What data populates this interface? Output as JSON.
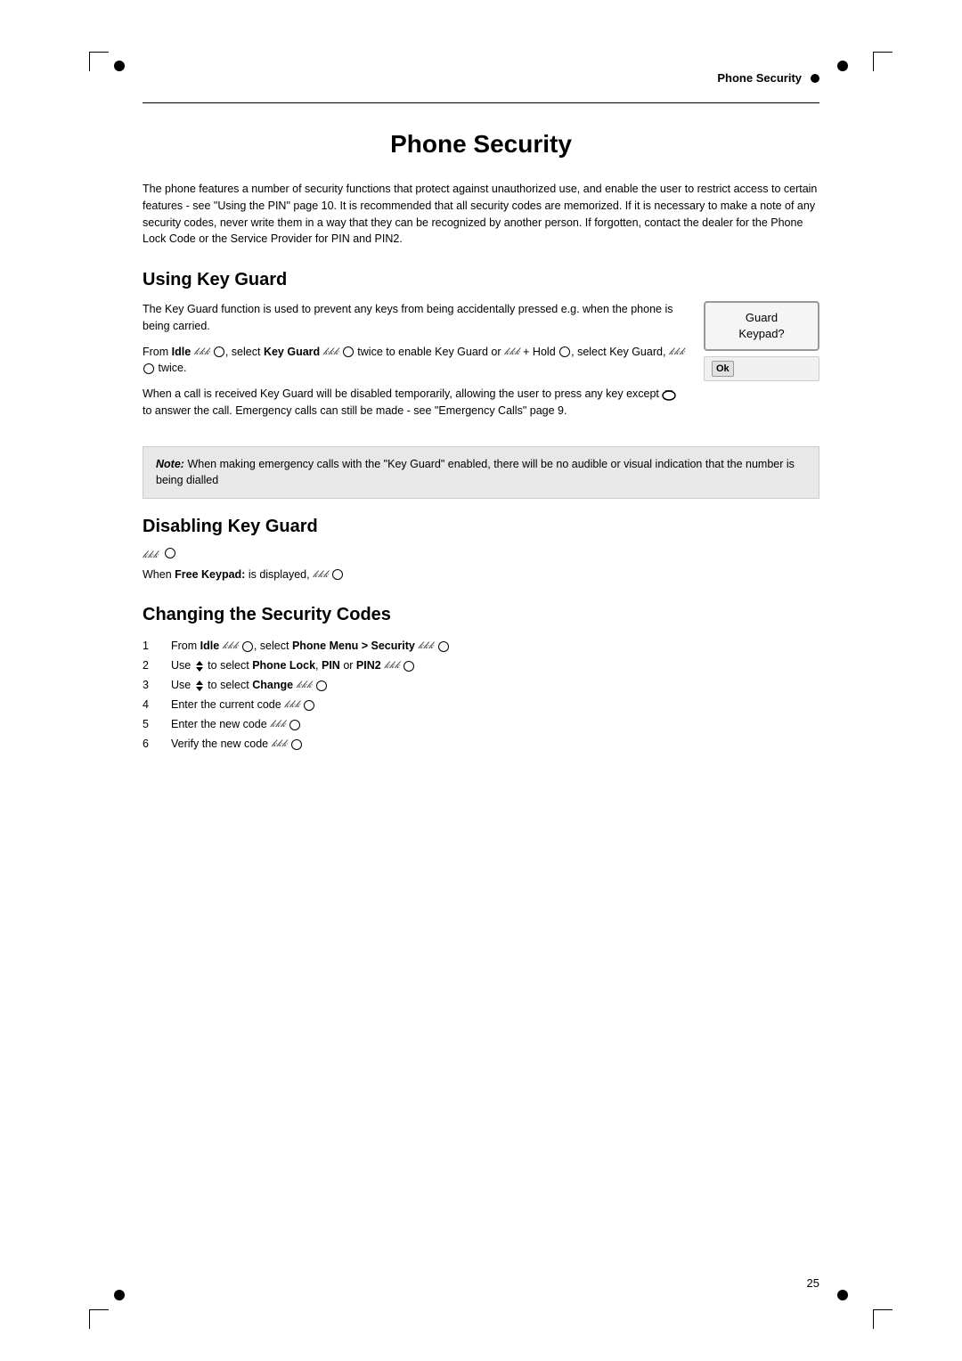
{
  "page": {
    "number": "25",
    "header": {
      "title": "Phone Security"
    },
    "main_title": "Phone Security",
    "intro_paragraph": "The phone features a number of security functions that protect against unauthorized use, and enable the user to restrict access to certain features - see \"Using the PIN\" page 10. It is recommended that all security codes are memorized. If it is necessary to make a note of any security codes, never write them in a way that they can be recognized by another person. If forgotten, contact the dealer for the Phone Lock Code or the Service Provider for PIN and PIN2.",
    "sections": {
      "using_key_guard": {
        "heading": "Using Key Guard",
        "paragraph1": "The Key Guard function is used to prevent any keys from being accidentally pressed e.g. when the phone is being carried.",
        "paragraph2_prefix": "From ",
        "paragraph2_idle": "Idle",
        "paragraph2_mid": ", select ",
        "paragraph2_key_guard": "Key Guard",
        "paragraph2_suffix": " twice to enable Key Guard or",
        "paragraph2_hold": "+ Hold",
        "paragraph2_end": ", select Key Guard,",
        "paragraph2_twice": " twice.",
        "paragraph3": "When a call is received Key Guard will be disabled temporarily, allowing the user to press any key except",
        "paragraph3_suffix": "to answer the call. Emergency calls can still be made - see \"Emergency Calls\" page 9.",
        "phone_display": {
          "text": "Guard\nKeypad?",
          "btn_ok": "Ok",
          "btn_cancel": ""
        },
        "note": {
          "prefix": "Note:",
          "text": " When making emergency calls with the \"Key Guard\" enabled, there will be no audible or visual indication that the number is being dialled"
        }
      },
      "disabling_key_guard": {
        "heading": "Disabling Key Guard",
        "line1": "When ",
        "line1_bold": "Free Keypad:",
        "line1_suffix": " is displayed,"
      },
      "changing_security_codes": {
        "heading": "Changing the Security Codes",
        "steps": [
          {
            "num": "1",
            "prefix": "From ",
            "idle": "Idle",
            "mid": ", select ",
            "bold": "Phone Menu > Security"
          },
          {
            "num": "2",
            "prefix": "Use",
            "nav": "↕",
            "mid": "to select ",
            "bold": "Phone Lock",
            "sep1": ", ",
            "bold2": "PIN",
            "sep2": " or ",
            "bold3": "PIN2"
          },
          {
            "num": "3",
            "prefix": "Use",
            "nav": "↕",
            "mid": "to select ",
            "bold": "Change"
          },
          {
            "num": "4",
            "text": "Enter the current code"
          },
          {
            "num": "5",
            "text": "Enter the new code"
          },
          {
            "num": "6",
            "text": "Verify the new code"
          }
        ]
      }
    }
  }
}
